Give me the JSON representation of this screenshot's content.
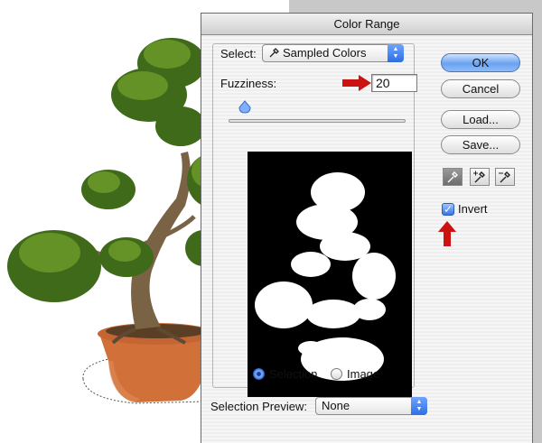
{
  "dialog": {
    "title": "Color Range",
    "select_label": "Select:",
    "select_value": "Sampled Colors",
    "fuzziness_label": "Fuzziness:",
    "fuzziness_value": "20",
    "fuzziness_slider_level": 0.1,
    "radio_selection": "Selection",
    "radio_image": "Image",
    "selected_radio": "Selection",
    "preview_label": "Selection Preview:",
    "preview_value": "None",
    "invert_label": "Invert",
    "invert_checked": true
  },
  "buttons": {
    "ok": "OK",
    "cancel": "Cancel",
    "load": "Load...",
    "save": "Save..."
  },
  "tools": [
    "eyedropper-icon",
    "eyedropper-plus-icon",
    "eyedropper-minus-icon"
  ],
  "colors": {
    "annotation_arrow": "#cc1111",
    "default_button": "#6aa2f0"
  }
}
